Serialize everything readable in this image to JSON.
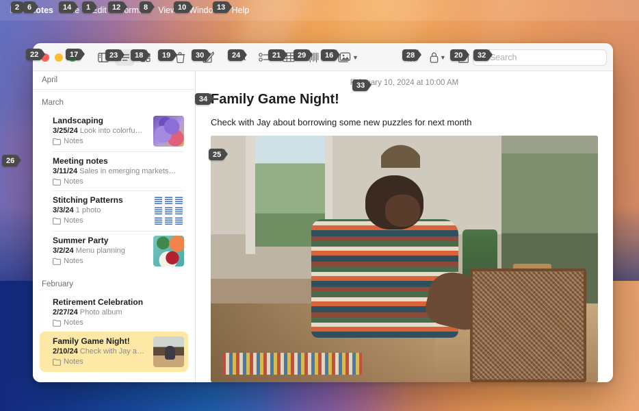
{
  "menubar": {
    "apple_icon": "apple-logo-icon",
    "items": [
      {
        "label": "Notes",
        "bold": true
      },
      {
        "label": "File",
        "bold": false
      },
      {
        "label": "Edit",
        "bold": false
      },
      {
        "label": "Format",
        "bold": false
      },
      {
        "label": "View",
        "bold": false
      },
      {
        "label": "Window",
        "bold": false
      },
      {
        "label": "Help",
        "bold": false
      }
    ]
  },
  "toolbar": {
    "traffic_lights": {
      "close": "close-button",
      "minimize": "minimize-button",
      "zoom": "zoom-button"
    },
    "sidebar_toggle": "sidebar-toggle-icon",
    "list_view": "list-view-icon",
    "gallery_view": "gallery-view-icon",
    "delete": "trash-icon",
    "compose": "compose-note-icon",
    "format_text": "Aa",
    "checklist": "checklist-icon",
    "table": "table-icon",
    "link": "link-icon",
    "media": "media-icon",
    "media_chevron": "chevron-down-icon",
    "collaborate": "collaborate-icon",
    "lock": "lock-icon",
    "lock_chevron": "chevron-down-icon",
    "share": "share-icon",
    "search_icon": "search-icon",
    "search_placeholder": "Search",
    "search_value": ""
  },
  "notes_list": {
    "pinned_header": "April",
    "sections": [
      {
        "header": "March",
        "notes": [
          {
            "title": "Landscaping",
            "date": "3/25/24",
            "preview": "Look into colorfu…",
            "folder": "Notes",
            "thumb": "th-flower",
            "selected": false
          },
          {
            "title": "Meeting notes",
            "date": "3/11/24",
            "preview": "Sales in emerging markets…",
            "folder": "Notes",
            "thumb": "",
            "selected": false
          },
          {
            "title": "Stitching Patterns",
            "date": "3/3/24",
            "preview": "1 photo",
            "folder": "Notes",
            "thumb": "th-stitch",
            "selected": false
          },
          {
            "title": "Summer Party",
            "date": "3/2/24",
            "preview": "Menu planning",
            "folder": "Notes",
            "thumb": "th-food",
            "selected": false
          }
        ]
      },
      {
        "header": "February",
        "notes": [
          {
            "title": "Retirement Celebration",
            "date": "2/27/24",
            "preview": "Photo album",
            "folder": "Notes",
            "thumb": "",
            "selected": false
          },
          {
            "title": "Family Game Night!",
            "date": "2/10/24",
            "preview": "Check with Jay a…",
            "folder": "Notes",
            "thumb": "th-game",
            "selected": true
          }
        ]
      }
    ],
    "folder_icon": "folder-icon"
  },
  "note_detail": {
    "timestamp": "February 10, 2024 at 10:00 AM",
    "title": "Family Game Night!",
    "body": "Check with Jay about borrowing some new puzzles for next month",
    "photo_alt": "boy-at-puzzle-table-photo"
  },
  "badges": {
    "b2": "2",
    "b6": "6",
    "b14": "14",
    "b1": "1",
    "b12": "12",
    "b8": "8",
    "b10": "10",
    "b13": "13",
    "b22": "22",
    "b17": "17",
    "b23": "23",
    "b18": "18",
    "b19": "19",
    "b30": "30",
    "b24": "24",
    "b21": "21",
    "b29": "29",
    "b16": "16",
    "b28": "28",
    "b20": "20",
    "b32": "32",
    "b26": "26",
    "b25": "25",
    "b33": "33",
    "b34": "34"
  },
  "colors": {
    "selection": "#fde8a6",
    "traffic_red": "#ff5f57",
    "traffic_yellow": "#febc2e",
    "traffic_green": "#28c840",
    "badge": "#4a4a4a"
  }
}
